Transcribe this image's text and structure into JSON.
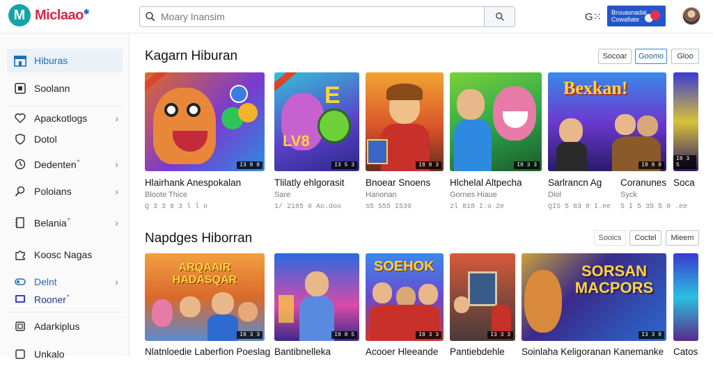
{
  "brand": {
    "logo_letter": "M",
    "name": "Miclaao",
    "mark": "✱"
  },
  "search": {
    "placeholder": "Moary Inansim",
    "value": ""
  },
  "header": {
    "lang_label": "G⁙",
    "promo_text": "Bruuasnadal Cowafiate",
    "colors": {
      "accent": "#2456c9",
      "brand": "#d8264a",
      "teal": "#14a3a8"
    }
  },
  "sidebar": {
    "items": [
      {
        "label": "Hiburas",
        "icon": "store-icon",
        "active": true
      },
      {
        "label": "Soolann",
        "icon": "square-icon"
      },
      {
        "label": "Apackotlogs",
        "icon": "heart-icon",
        "chevron": true
      },
      {
        "label": "Dotol",
        "icon": "shield-icon"
      },
      {
        "label": "Dedenten",
        "icon": "clock-icon",
        "chevron": true,
        "star": "*"
      },
      {
        "label": "Poloians",
        "icon": "search-icon",
        "chevron": true
      },
      {
        "label": "Belania",
        "icon": "document-icon",
        "chevron": true,
        "star": "*"
      },
      {
        "label": "Koosc Nagas",
        "icon": "puzzle-icon"
      },
      {
        "label": "Delnt",
        "icon": "toggle-icon",
        "chevron": true,
        "blue": true
      },
      {
        "label": "Rooner",
        "icon": "monitor-icon",
        "star": "*",
        "blue": true
      },
      {
        "label": "Adarkiplus",
        "icon": "square-icon"
      },
      {
        "label": "Unkalo",
        "icon": "square-icon"
      }
    ]
  },
  "section1": {
    "title": "Kagarn Hiburan",
    "filters": [
      "Socoar",
      "Goomo",
      "Gloo"
    ],
    "cards": [
      {
        "title": "Hlairhank Anespokalan",
        "sub": "Bloote Thice",
        "meta": "Q 3 3 8 3 l l o",
        "tag": "I3 8 8"
      },
      {
        "title": "Tlilatly ehlgorasit",
        "sub": "Sare",
        "meta": "1/ 2185 0 Ao.doo",
        "tag": "I3 5 3"
      },
      {
        "title": "Bnoear Snoens",
        "sub": "Hanonan",
        "meta": "S5 555 I539",
        "tag": "I8 8 3"
      },
      {
        "title": "Hlchelal Altpecha",
        "sub": "Gornes Hiaue",
        "meta": "2l 818 I.o 2e",
        "tag": "I8 3 3"
      },
      {
        "title": "Sarlrancn Ag",
        "sub": "Dlol",
        "meta": "QIS 5 83 8 I.ee",
        "tag": "I8 8 8"
      },
      {
        "title": "Coranunes",
        "sub": "Syck",
        "meta": "5 I 5 35 5 0 .ee",
        "tag": ""
      },
      {
        "title": "Soca",
        "sub": "",
        "meta": "",
        "tag": "I8 3 5"
      }
    ]
  },
  "section2": {
    "title": "Napdges Hiborran",
    "filters": [
      "Sooics",
      "Coctel",
      "Mieem"
    ],
    "cards": [
      {
        "title": "Nlatnloedie Laberfion Poeslag",
        "overlay": "ARQAAIR HADASQAR",
        "tag": "I8 3 3"
      },
      {
        "title": "Bantibnelleka",
        "overlay": "",
        "tag": "I8 8 5"
      },
      {
        "title": "Acooer Hleeande",
        "overlay": "SOEHOK",
        "tag": "I8 3 3"
      },
      {
        "title": "Pantiebdehle",
        "overlay": "",
        "tag": "I3 3 3"
      },
      {
        "title": "Soinlaha Keligoranan Kanemanke",
        "overlay": "SORSAN MACPORS",
        "tag": "I3 3 8"
      },
      {
        "title": "Catos",
        "overlay": "",
        "tag": ""
      }
    ]
  },
  "section1_banner": "Bexkan!",
  "section1_letter": "E",
  "section1_lvl": "LV8"
}
